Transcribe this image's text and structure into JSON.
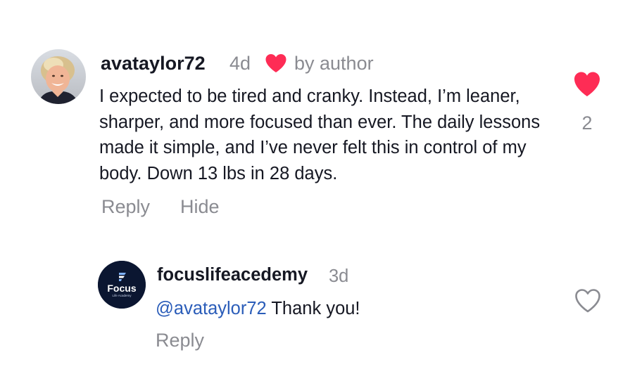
{
  "comment": {
    "username": "avataylor72",
    "time": "4d",
    "by_author": "by author",
    "text": "I expected to be tired and cranky. Instead, I’m leaner, sharper, and more focused than ever. The daily lessons made it simple, and I’ve never felt this in control of my body. Down 13 lbs in 28 days.",
    "reply_label": "Reply",
    "hide_label": "Hide",
    "like_count": "2",
    "liked": true,
    "author_liked": true,
    "like_icon": "heart-filled-icon",
    "colors": {
      "heart": "#fe2c55",
      "muted": "#8a8b91",
      "text": "#161823"
    }
  },
  "reply": {
    "username": "focuslifeacedemy",
    "time": "3d",
    "mention": "@avataylor72",
    "text": " Thank you!",
    "reply_label": "Reply",
    "liked": false,
    "like_icon": "heart-outline-icon",
    "avatar": {
      "brand": "Focus",
      "tagline": "Life Academy",
      "background": "#0b1631"
    },
    "colors": {
      "mention": "#2b5db9"
    }
  }
}
